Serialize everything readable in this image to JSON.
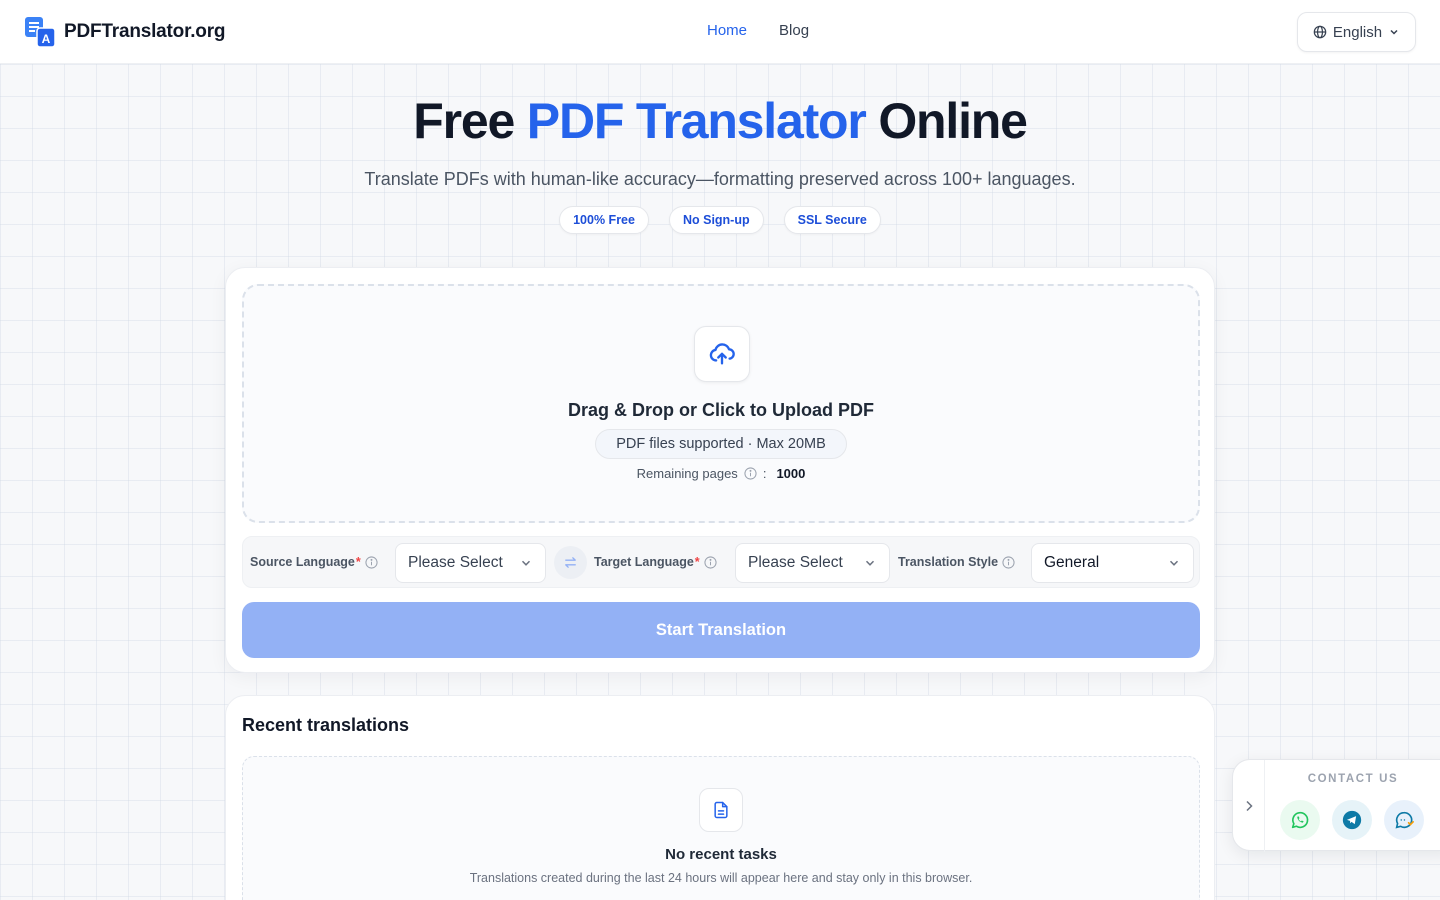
{
  "header": {
    "brand": "PDFTranslator.org",
    "nav": [
      {
        "label": "Home",
        "active": true
      },
      {
        "label": "Blog",
        "active": false
      }
    ],
    "language": "English"
  },
  "hero": {
    "title_prefix": "Free",
    "title_accent": "PDF Translator",
    "title_suffix": "Online",
    "subtitle": "Translate PDFs with human-like accuracy—formatting preserved across 100+ languages.",
    "badges": [
      "100% Free",
      "No Sign-up",
      "SSL Secure"
    ]
  },
  "upload": {
    "title": "Drag & Drop or Click to Upload PDF",
    "hint": "PDF files supported · Max 20MB",
    "remaining_label": "Remaining pages",
    "remaining_sep": ":",
    "remaining_value": "1000"
  },
  "options": {
    "source_label": "Source Language",
    "source_value": "Please Select",
    "target_label": "Target Language",
    "target_value": "Please Select",
    "style_label": "Translation Style",
    "style_value": "General",
    "required_mark": "*"
  },
  "start_button": "Start Translation",
  "recent": {
    "title": "Recent translations",
    "empty_title": "No recent tasks",
    "empty_sub": "Translations created during the last 24 hours will appear here and stay only in this browser."
  },
  "contact": {
    "title": "CONTACT US",
    "channels": [
      "whatsapp-icon",
      "telegram-icon",
      "chat-icon"
    ]
  },
  "colors": {
    "accent": "#2563eb",
    "button_disabled": "#93b1f5",
    "required": "#ef4444",
    "whatsapp": "#22c55e",
    "telegram": "#0e7aa6"
  }
}
